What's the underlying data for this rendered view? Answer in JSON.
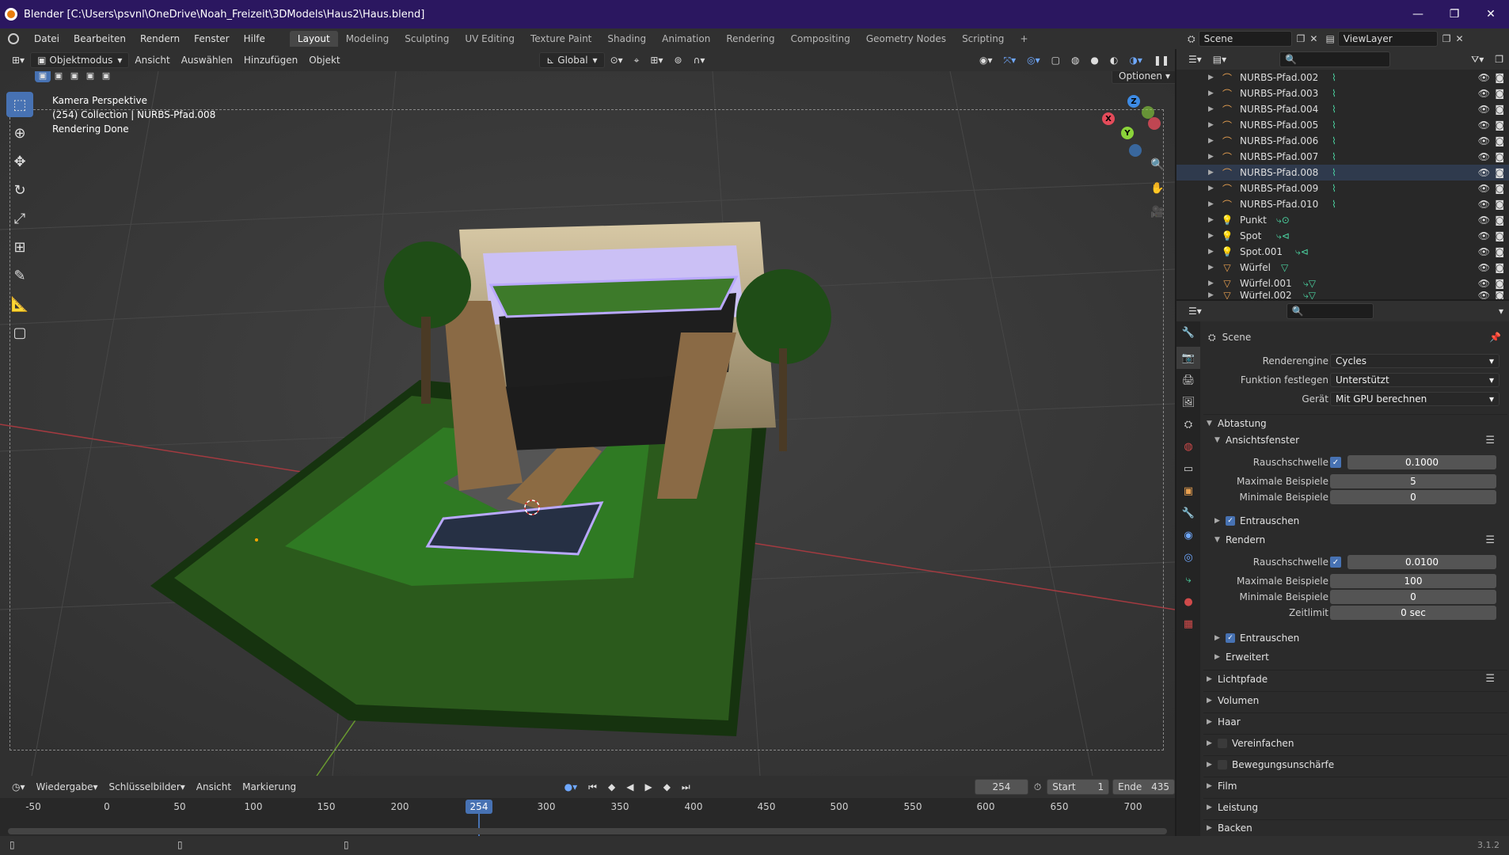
{
  "window": {
    "title": "Blender [C:\\Users\\psvnl\\OneDrive\\Noah_Freizeit\\3DModels\\Haus2\\Haus.blend]",
    "minimize": "—",
    "maximize": "❐",
    "close": "✕"
  },
  "menu": [
    "Datei",
    "Bearbeiten",
    "Rendern",
    "Fenster",
    "Hilfe"
  ],
  "workspaces": {
    "active": "Layout",
    "tabs": [
      "Layout",
      "Modeling",
      "Sculpting",
      "UV Editing",
      "Texture Paint",
      "Shading",
      "Animation",
      "Rendering",
      "Compositing",
      "Geometry Nodes",
      "Scripting"
    ],
    "add": "+"
  },
  "scene": {
    "name": "Scene",
    "view_layer": "ViewLayer"
  },
  "viewport_header": {
    "mode": "Objektmodus",
    "menus": [
      "Ansicht",
      "Auswählen",
      "Hinzufügen",
      "Objekt"
    ],
    "transform": "Global",
    "options": "Optionen"
  },
  "viewport_info": {
    "line1": "Kamera Perspektive",
    "line2": "(254) Collection | NURBS-Pfad.008",
    "line3": "Rendering Done"
  },
  "gizmo": {
    "x": "X",
    "y": "Y",
    "z": "Z"
  },
  "colors": {
    "accent": "#4772b3",
    "titlebar": "#2b1760",
    "x_axis": "#e44b5a",
    "y_axis": "#8bd43a",
    "z_axis": "#3d8be5"
  },
  "timeline": {
    "menus": [
      "Wiedergabe",
      "Schlüsselbilder",
      "Ansicht",
      "Markierung"
    ],
    "current_frame": "254",
    "start_label": "Start",
    "start": "1",
    "end_label": "Ende",
    "end": "435",
    "ticks": [
      "-50",
      "0",
      "50",
      "100",
      "150",
      "200",
      "300",
      "350",
      "400",
      "450",
      "500",
      "550",
      "600",
      "650",
      "700"
    ]
  },
  "outliner": {
    "items": [
      {
        "name": "NURBS-Pfad.002",
        "type": "curve"
      },
      {
        "name": "NURBS-Pfad.003",
        "type": "curve"
      },
      {
        "name": "NURBS-Pfad.004",
        "type": "curve"
      },
      {
        "name": "NURBS-Pfad.005",
        "type": "curve"
      },
      {
        "name": "NURBS-Pfad.006",
        "type": "curve"
      },
      {
        "name": "NURBS-Pfad.007",
        "type": "curve"
      },
      {
        "name": "NURBS-Pfad.008",
        "type": "curve"
      },
      {
        "name": "NURBS-Pfad.009",
        "type": "curve"
      },
      {
        "name": "NURBS-Pfad.010",
        "type": "curve"
      },
      {
        "name": "Punkt",
        "type": "light"
      },
      {
        "name": "Spot",
        "type": "light"
      },
      {
        "name": "Spot.001",
        "type": "light"
      },
      {
        "name": "Würfel",
        "type": "mesh"
      },
      {
        "name": "Würfel.001",
        "type": "mesh"
      },
      {
        "name": "Würfel.002",
        "type": "mesh"
      }
    ]
  },
  "properties": {
    "context": "Scene",
    "render_engine_label": "Renderengine",
    "render_engine": "Cycles",
    "feature_set_label": "Funktion festlegen",
    "feature_set": "Unterstützt",
    "device_label": "Gerät",
    "device": "Mit GPU berechnen",
    "sampling": "Abtastung",
    "viewport_panel": "Ansichtsfenster",
    "noise_threshold_label": "Rauschschwelle",
    "viewport_noise_threshold": "0.1000",
    "max_samples_label": "Maximale Beispiele",
    "viewport_max_samples": "5",
    "min_samples_label": "Minimale Beispiele",
    "viewport_min_samples": "0",
    "denoise_label": "Entrauschen",
    "render_panel": "Rendern",
    "render_noise_threshold": "0.0100",
    "render_max_samples": "100",
    "render_min_samples": "0",
    "time_limit_label": "Zeitlimit",
    "time_limit": "0 sec",
    "advanced": "Erweitert",
    "panels": [
      "Lichtpfade",
      "Volumen",
      "Haar",
      "Vereinfachen",
      "Bewegungsunschärfe",
      "Film",
      "Leistung",
      "Backen"
    ]
  },
  "version": "3.1.2"
}
